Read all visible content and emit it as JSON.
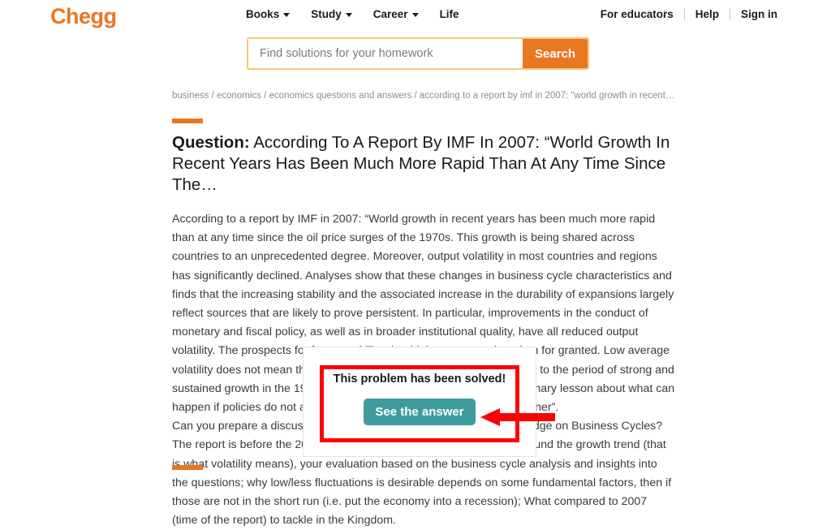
{
  "header": {
    "logo": "Chegg",
    "nav": [
      {
        "label": "Books",
        "has_caret": true
      },
      {
        "label": "Study",
        "has_caret": true
      },
      {
        "label": "Career",
        "has_caret": true
      },
      {
        "label": "Life",
        "has_caret": false
      }
    ],
    "utility": [
      {
        "label": "For educators"
      },
      {
        "label": "Help"
      },
      {
        "label": "Sign in"
      }
    ]
  },
  "search": {
    "value": "",
    "placeholder": "Find solutions for your homework",
    "button_label": "Search"
  },
  "breadcrumb": "business / economics / economics questions and answers / according to a report by imf in 2007: “world growth in recent…",
  "question": {
    "label": "Question:",
    "title": " According To A Report By IMF In 2007: “World Growth In Recent Years Has Been Much More Rapid Than At Any Time Since The…",
    "paragraph_1": "According to a report by IMF in 2007: “World growth in recent years has been much more rapid than at any time since the oil price surges of the 1970s. This growth is being shared across countries to an unprecedented degree. Moreover, output volatility in most countries and regions has significantly declined. Analyses show that these changes in business cycle characteristics and finds that the increasing stability and the associated increase in the durability of expansions largely reflect sources that are likely to prove persistent. In particular, improvements in the conduct of monetary and fiscal policy, as well as in broader institutional quality, have all reduced output volatility. The prospects for future stability should, however, not be taken for granted. Low average volatility does not mean that the business cycle is dead. The abrupt end to the period of strong and sustained growth in the 1960s and early 1970s provides a useful cautionary lesson about what can happen if policies do not adjust to tackle emerging risks in a timely manner”.",
    "paragraph_2": "Can you prepare a discussion of the above passage using your knowledge on Business Cycles? The report is before the 2008 Crisis. Although there are fluctuations around the growth trend (that is what volatility means), your evaluation based on the business cycle analysis and insights into the questions; why low/less fluctuations is desirable depends on some fundamental factors, then if those are not in the short run (i.e. put the economy into a recession); What compared to 2007 (time of the report) to tackle in the Kingdom."
  },
  "overlay": {
    "solved_message": "This problem has been solved!",
    "cta_label": "See the answer"
  },
  "colors": {
    "brand_orange": "#e87722",
    "cta_teal": "#3f9c9c",
    "annotation_red": "#ff0000",
    "search_border": "#f7c873"
  }
}
